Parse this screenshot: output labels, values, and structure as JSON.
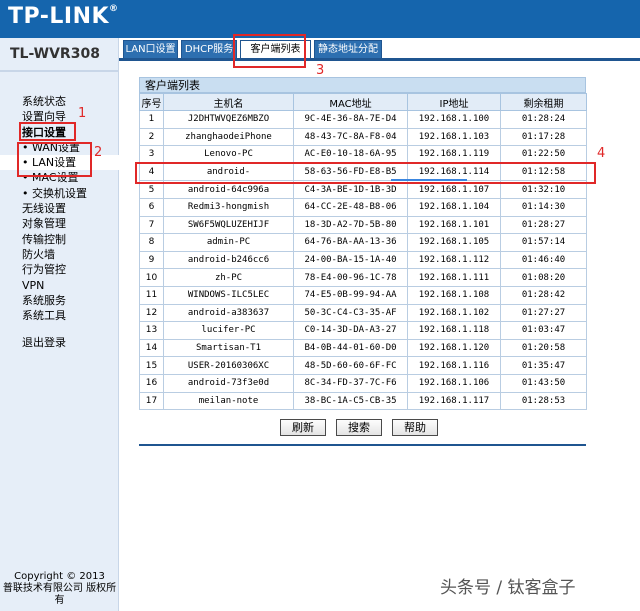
{
  "header": {
    "logo": "TP-LINK",
    "logo_mark": "®"
  },
  "sidebar": {
    "model": "TL-WVR308",
    "items": [
      {
        "label": "系统状态",
        "type": "normal"
      },
      {
        "label": "设置向导",
        "type": "normal"
      },
      {
        "label": "接口设置",
        "type": "bold"
      },
      {
        "label": "• WAN设置",
        "type": "sub"
      },
      {
        "label": "• LAN设置",
        "type": "sub-active"
      },
      {
        "label": "• MAC设置",
        "type": "sub"
      },
      {
        "label": "• 交换机设置",
        "type": "sub"
      },
      {
        "label": "无线设置",
        "type": "normal"
      },
      {
        "label": "对象管理",
        "type": "normal"
      },
      {
        "label": "传输控制",
        "type": "normal"
      },
      {
        "label": "防火墙",
        "type": "normal"
      },
      {
        "label": "行为管控",
        "type": "normal"
      },
      {
        "label": "VPN",
        "type": "normal"
      },
      {
        "label": "系统服务",
        "type": "normal"
      },
      {
        "label": "系统工具",
        "type": "normal"
      },
      {
        "label": "退出登录",
        "type": "logout"
      }
    ],
    "copyright_line1": "Copyright © 2013",
    "copyright_line2": "普联技术有限公司 版权所",
    "copyright_line3": "有"
  },
  "tabs": [
    {
      "label": "LAN口设置"
    },
    {
      "label": "DHCP服务"
    },
    {
      "label": "客户端列表"
    },
    {
      "label": "静态地址分配"
    }
  ],
  "client_list": {
    "title": "客户端列表",
    "columns": [
      "序号",
      "主机名",
      "MAC地址",
      "IP地址",
      "剩余租期"
    ],
    "rows": [
      [
        "1",
        "J2DHTWVQEZ6MBZO",
        "9C-4E-36-8A-7E-D4",
        "192.168.1.100",
        "01:28:24"
      ],
      [
        "2",
        "zhanghaodeiPhone",
        "48-43-7C-8A-F8-04",
        "192.168.1.103",
        "01:17:28"
      ],
      [
        "3",
        "Lenovo-PC",
        "AC-E0-10-18-6A-95",
        "192.168.1.119",
        "01:22:50"
      ],
      [
        "4",
        "android-",
        "58-63-56-FD-E8-B5",
        "192.168.1.114",
        "01:12:58"
      ],
      [
        "5",
        "android-64c996a",
        "C4-3A-BE-1D-1B-3D",
        "192.168.1.107",
        "01:32:10"
      ],
      [
        "6",
        "Redmi3-hongmish",
        "64-CC-2E-48-B8-06",
        "192.168.1.104",
        "01:14:30"
      ],
      [
        "7",
        "SW6F5WQLUZEHIJF",
        "18-3D-A2-7D-5B-80",
        "192.168.1.101",
        "01:28:27"
      ],
      [
        "8",
        "admin-PC",
        "64-76-BA-AA-13-36",
        "192.168.1.105",
        "01:57:14"
      ],
      [
        "9",
        "android-b246cc6",
        "24-00-BA-15-1A-40",
        "192.168.1.112",
        "01:46:40"
      ],
      [
        "10",
        "zh-PC",
        "78-E4-00-96-1C-78",
        "192.168.1.111",
        "01:08:20"
      ],
      [
        "11",
        "WINDOWS-ILC5LEC",
        "74-E5-0B-99-94-AA",
        "192.168.1.108",
        "01:28:42"
      ],
      [
        "12",
        "android-a383637",
        "50-3C-C4-C3-35-AF",
        "192.168.1.102",
        "01:27:27"
      ],
      [
        "13",
        "lucifer-PC",
        "C0-14-3D-DA-A3-27",
        "192.168.1.118",
        "01:03:47"
      ],
      [
        "14",
        "Smartisan-T1",
        "B4-0B-44-01-60-D0",
        "192.168.1.120",
        "01:20:58"
      ],
      [
        "15",
        "USER-20160306XC",
        "48-5D-60-60-6F-FC",
        "192.168.1.116",
        "01:35:47"
      ],
      [
        "16",
        "android-73f3e0d",
        "8C-34-FD-37-7C-F6",
        "192.168.1.106",
        "01:43:50"
      ],
      [
        "17",
        "meilan-note",
        "38-BC-1A-C5-CB-35",
        "192.168.1.117",
        "01:28:53"
      ]
    ]
  },
  "buttons": {
    "refresh": "刷新",
    "search": "搜索",
    "help": "帮助"
  },
  "annotations": {
    "n1": "1",
    "n2": "2",
    "n3": "3",
    "n4": "4"
  },
  "watermark": "头条号 / 钛客盒子",
  "colors": {
    "header_blue": "#1565ad",
    "annotation_red": "#e02828"
  }
}
